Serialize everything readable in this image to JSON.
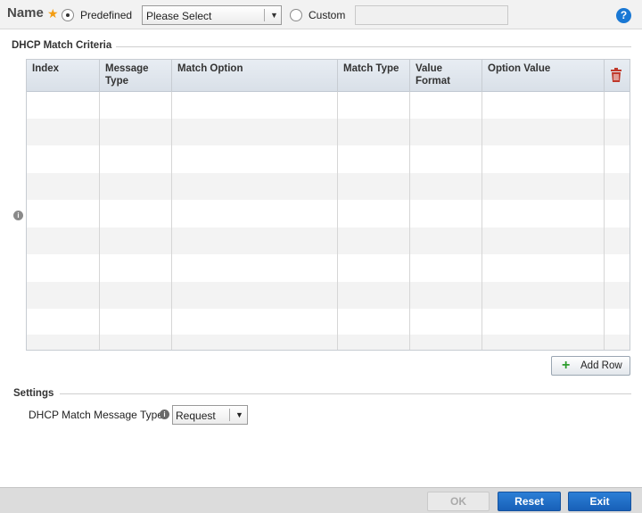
{
  "header": {
    "name_label": "Name",
    "required_icon": "star-icon",
    "predefined_label": "Predefined",
    "predefined_selected": true,
    "select_value": "Please Select",
    "custom_label": "Custom",
    "custom_value": "",
    "help_icon": "?"
  },
  "criteria": {
    "title": "DHCP Match Criteria",
    "columns": [
      "Index",
      "Message Type",
      "Match Option",
      "Match Type",
      "Value Format",
      "Option Value"
    ],
    "rows": [],
    "delete_icon": "trash-icon",
    "info_icon": "i",
    "add_row_label": "Add Row"
  },
  "settings": {
    "title": "Settings",
    "message_type_label": "DHCP Match Message Type",
    "message_type_value": "Request",
    "info_icon": "i"
  },
  "footer": {
    "ok_label": "OK",
    "reset_label": "Reset",
    "exit_label": "Exit"
  },
  "colors": {
    "accent": "#1a78d4",
    "required_star": "#f39c12",
    "add_plus": "#2e9d2e",
    "delete_red": "#c0392b"
  }
}
